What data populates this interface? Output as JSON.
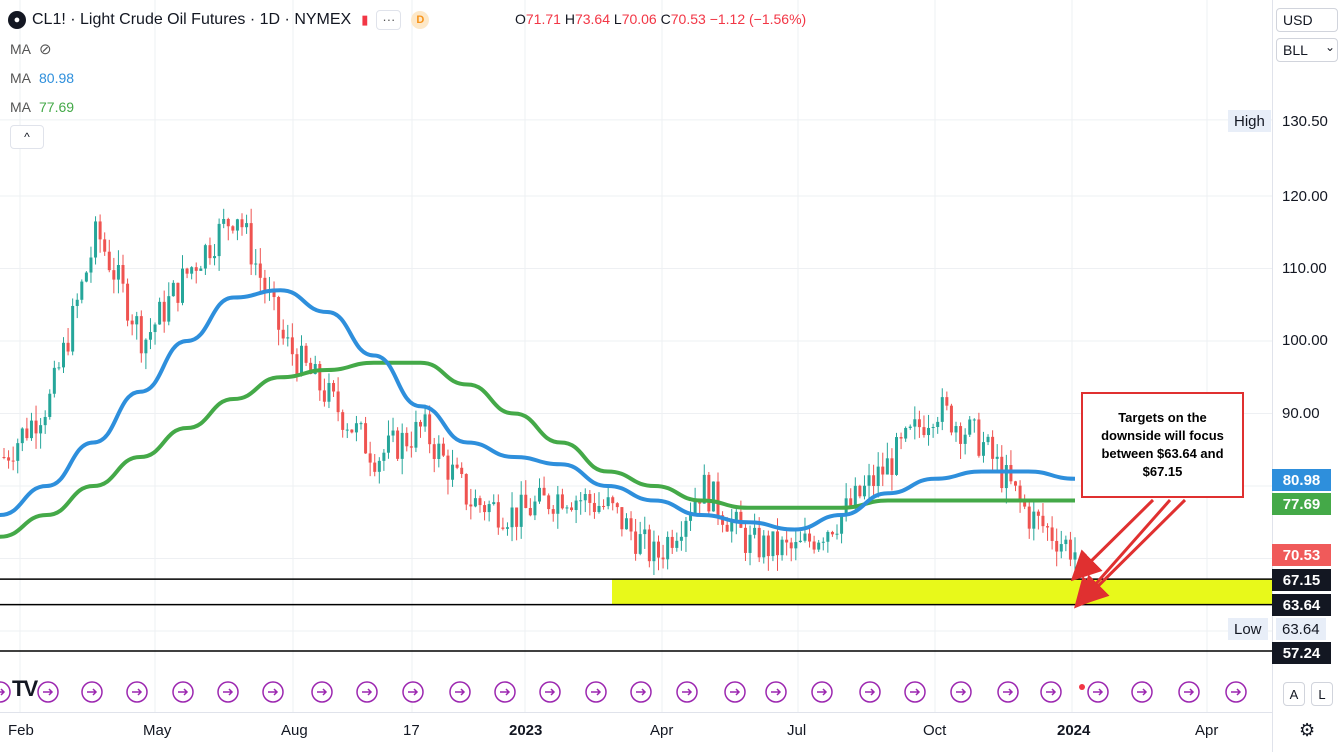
{
  "header": {
    "symbol_icon": "oil-drop-icon",
    "title": "CL1! · Light Crude Oil Futures · 1D · NYMEX",
    "flag_icon": "flag-icon",
    "more_label": "···",
    "badge": "D",
    "ohlc": {
      "o_key": "O",
      "o": "71.71",
      "h_key": "H",
      "h": "73.64",
      "l_key": "L",
      "l": "70.06",
      "c_key": "C",
      "c": "70.53",
      "change": "−1.12 (−1.56%)"
    }
  },
  "indicators": [
    {
      "label": "MA",
      "value": "",
      "icon": "eye-off-icon"
    },
    {
      "label": "MA",
      "value": "80.98",
      "color": "#2e8fdc"
    },
    {
      "label": "MA",
      "value": "77.69",
      "color": "#44a948"
    }
  ],
  "collapse_label": "^",
  "currency": {
    "label": "USD",
    "unit": "BLL"
  },
  "price_ticks": [
    "130.50",
    "120.00",
    "110.00",
    "100.00",
    "90.00"
  ],
  "high": {
    "label": "High",
    "value": "130.50"
  },
  "low": {
    "label": "Low",
    "value": "63.64"
  },
  "price_labels": [
    {
      "value": "80.98",
      "color": "#2e8fdc"
    },
    {
      "value": "77.69",
      "color": "#44a948"
    },
    {
      "value": "70.53",
      "color": "#f05a5a"
    },
    {
      "value": "67.15",
      "color": "#131722"
    },
    {
      "value": "63.64",
      "color": "#131722"
    },
    {
      "value": "57.24",
      "color": "#131722"
    }
  ],
  "annotation": "Targets on the downside will focus between $63.64 and $67.15",
  "x_labels": [
    "Feb",
    "May",
    "Aug",
    "17",
    "2023",
    "Apr",
    "Jul",
    "Oct",
    "2024",
    "Apr"
  ],
  "footer": {
    "logo": "TV",
    "btn_a": "A",
    "btn_l": "L",
    "settings_icon": "gear-icon"
  },
  "colors": {
    "ma_fast": "#2e8fdc",
    "ma_slow": "#44a948",
    "up": "#26a69a",
    "down": "#ef5350",
    "zone": "#e8f91a",
    "arrow": "#e03030"
  },
  "chart_data": {
    "type": "line",
    "title": "CL1! · Light Crude Oil Futures · 1D · NYMEX",
    "xlabel": "",
    "ylabel": "",
    "ylim": [
      55,
      135
    ],
    "x": [
      "2022-01",
      "2022-02",
      "2022-03",
      "2022-04",
      "2022-05",
      "2022-06",
      "2022-07",
      "2022-08",
      "2022-09",
      "2022-10",
      "2022-11",
      "2022-12",
      "2023-01",
      "2023-02",
      "2023-03",
      "2023-04",
      "2023-05",
      "2023-06",
      "2023-07",
      "2023-08",
      "2023-09",
      "2023-10",
      "2023-11",
      "2023-12"
    ],
    "series": [
      {
        "name": "CL1!",
        "values": [
          84,
          92,
          115,
          100,
          110,
          118,
          100,
          92,
          84,
          88,
          78,
          76,
          79,
          77,
          70,
          80,
          72,
          71,
          76,
          83,
          91,
          86,
          76,
          71
        ]
      },
      {
        "name": "MA",
        "values": [
          76,
          80,
          86,
          93,
          100,
          106,
          107,
          104,
          98,
          91,
          86,
          84,
          83,
          80,
          78,
          76,
          75,
          74,
          76,
          79,
          81,
          82,
          82,
          81
        ]
      },
      {
        "name": "MA",
        "values": [
          73,
          76,
          80,
          84,
          88,
          92,
          95,
          96,
          97,
          97,
          94,
          90,
          86,
          82,
          80,
          78,
          77,
          77,
          77,
          78,
          78,
          78,
          78,
          78
        ]
      }
    ],
    "horizontal_lines": [
      67.15,
      63.64,
      57.24
    ],
    "target_zone": [
      63.64,
      67.15
    ],
    "last_close": 70.53
  }
}
